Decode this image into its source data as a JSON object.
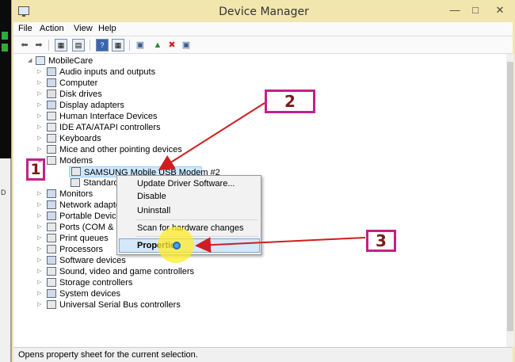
{
  "window": {
    "title": "Device Manager"
  },
  "menu": [
    "File",
    "Action",
    "View",
    "Help"
  ],
  "desktop": {
    "partial_label": "D"
  },
  "tree": {
    "root": "MobileCare",
    "items": [
      "Audio inputs and outputs",
      "Computer",
      "Disk drives",
      "Display adapters",
      "Human Interface Devices",
      "IDE ATA/ATAPI controllers",
      "Keyboards",
      "Mice and other pointing devices",
      "Modems",
      "SAMSUNG Mobile USB Modem #2",
      "Standard Mo",
      "Monitors",
      "Network adapter",
      "Portable Devices",
      "Ports (COM & LF",
      "Print queues",
      "Processors",
      "Software devices",
      "Sound, video and game controllers",
      "Storage controllers",
      "System devices",
      "Universal Serial Bus controllers"
    ]
  },
  "context_menu": {
    "items": [
      "Update Driver Software...",
      "Disable",
      "Uninstall",
      "Scan for hardware changes",
      "Properties"
    ]
  },
  "annotations": [
    "1",
    "2",
    "3"
  ],
  "status": "Opens property sheet for the current selection.",
  "colors": {
    "annotation": "#c4208a",
    "arrow": "#d01e1e",
    "cursor_highlight": "#ffec28"
  }
}
